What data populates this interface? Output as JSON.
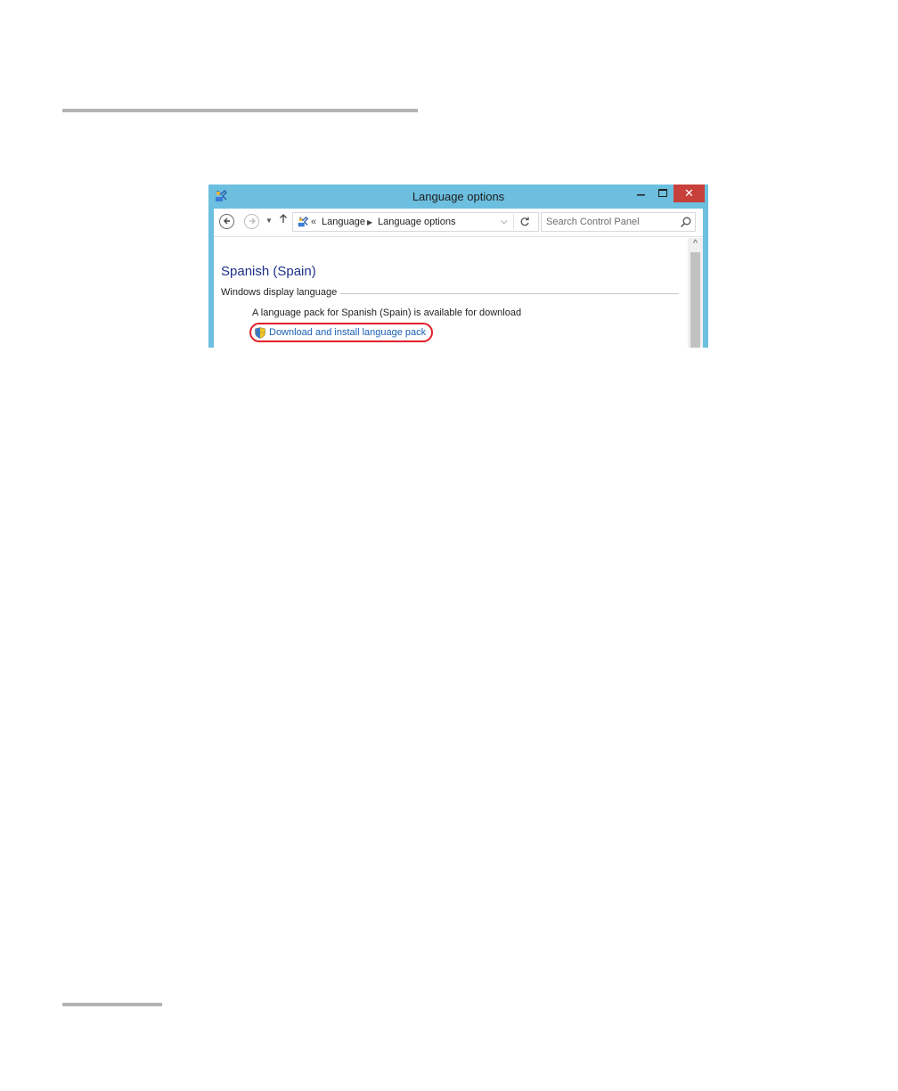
{
  "window": {
    "title": "Language options",
    "controls": {
      "minimize": "minimize",
      "maximize": "maximize",
      "close": "✕"
    }
  },
  "nav": {
    "back_icon": "back-arrow-icon",
    "forward_icon": "forward-arrow-icon",
    "up_icon": "up-arrow-icon"
  },
  "address": {
    "overflow": "«",
    "crumbs": [
      "Language",
      "Language options"
    ]
  },
  "search": {
    "placeholder": "Search Control Panel"
  },
  "content": {
    "title": "Spanish (Spain)",
    "section": "Windows display language",
    "availability": "A language pack for Spanish (Spain) is available for download",
    "download_link": "Download and install language pack"
  },
  "colors": {
    "titlebar": "#6cbfdf",
    "close_button": "#c7403b",
    "heading": "#1e3287",
    "link": "#1a5fb4",
    "highlight_circle": "#e21f2b"
  }
}
